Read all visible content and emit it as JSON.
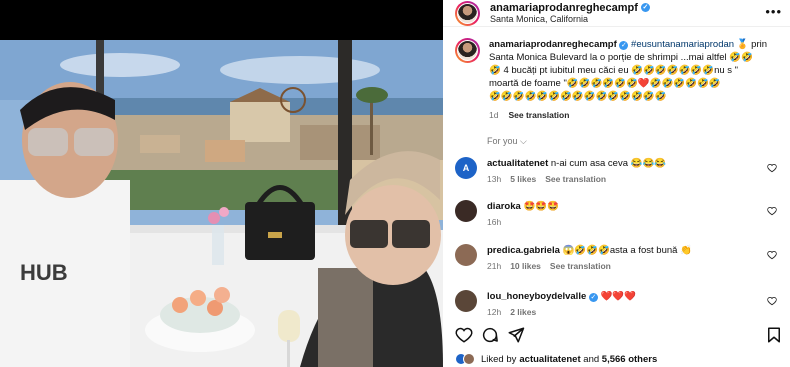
{
  "post": {
    "username": "anamariaprodanreghecampf",
    "location": "Santa Monica, California",
    "more_label": "•••"
  },
  "caption": {
    "username": "anamariaprodanreghecampf",
    "hashtag": "#eusuntanamariaprodan",
    "text_1": " 🏅 prin Santa Monica Bulevard la o porție de shrimpi ...mai altfel 🤣🤣",
    "text_2": "🤣 4 bucăți pt iubitul meu căci eu 🤣🤣🤣🤣🤣🤣🤣nu s \"",
    "text_3": "moartă de foame \"🤣🤣🤣🤣🤣🤣❤️🤣🤣🤣🤣🤣🤣",
    "text_4": "🤣🤣🤣🤣🤣🤣🤣🤣🤣🤣🤣🤣🤣🤣🤣",
    "time": "1d",
    "see_translation": "See translation"
  },
  "for_you": "For you",
  "comments": [
    {
      "username": "actualitatenet",
      "text": "n-ai cum asa ceva 😂😂😂",
      "time": "13h",
      "likes": "5 likes",
      "translate": "See translation",
      "avatar_letter": "A",
      "avatar_color": "#1d63c7"
    },
    {
      "username": "diaroka",
      "text": "🤩🤩🤩",
      "time": "16h",
      "likes": "",
      "translate": "",
      "avatar_letter": "",
      "avatar_color": "#3a2a25"
    },
    {
      "username": "predica.gabriela",
      "text": "😱🤣🤣🤣asta a fost bună 👏",
      "time": "21h",
      "likes": "10 likes",
      "translate": "See translation",
      "avatar_letter": "",
      "avatar_color": "#8c6a55"
    },
    {
      "username": "lou_honeyboydelvalle",
      "text": "❤️❤️❤️",
      "time": "12h",
      "likes": "2 likes",
      "translate": "",
      "avatar_letter": "",
      "avatar_color": "#5a4638"
    }
  ],
  "likes": {
    "prefix": "Liked by ",
    "user": "actualitatenet",
    "middle": " and ",
    "count": "5,566 others"
  },
  "icons": [
    "heart-icon",
    "comment-icon",
    "share-icon",
    "bookmark-icon",
    "verified-icon",
    "chevron-down-icon",
    "more-icon"
  ]
}
